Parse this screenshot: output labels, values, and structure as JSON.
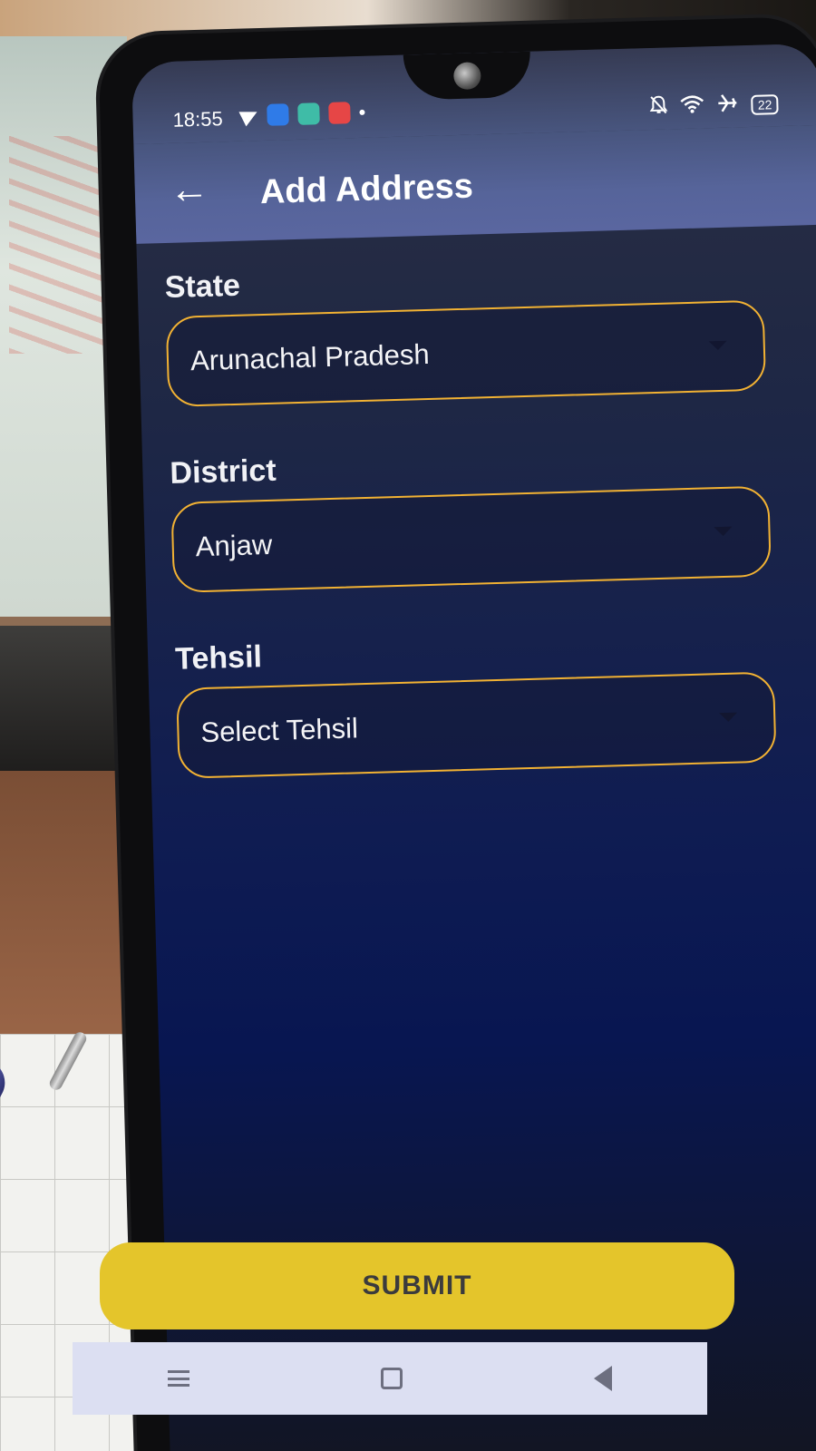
{
  "status_bar": {
    "time": "18:55",
    "battery": "22"
  },
  "app_bar": {
    "back_icon": "←",
    "title": "Add Address"
  },
  "form": {
    "state": {
      "label": "State",
      "value": "Arunachal Pradesh"
    },
    "district": {
      "label": "District",
      "value": "Anjaw"
    },
    "tehsil": {
      "label": "Tehsil",
      "value": "Select Tehsil"
    }
  },
  "submit": {
    "label": "SUBMIT"
  },
  "colors": {
    "accent_border": "#f2b233",
    "submit_bg": "#e4c52b",
    "app_bar_bg": "#56649a",
    "screen_bg": "#0f1c52"
  },
  "icons": {
    "status_left": [
      "telegram-icon",
      "blue-app-icon",
      "teal-app-icon",
      "red-app-icon",
      "dot-icon"
    ],
    "status_right": [
      "mute-icon",
      "wifi-icon",
      "airplane-icon",
      "battery-icon"
    ],
    "nav": [
      "recents-icon",
      "home-icon",
      "back-icon"
    ]
  }
}
